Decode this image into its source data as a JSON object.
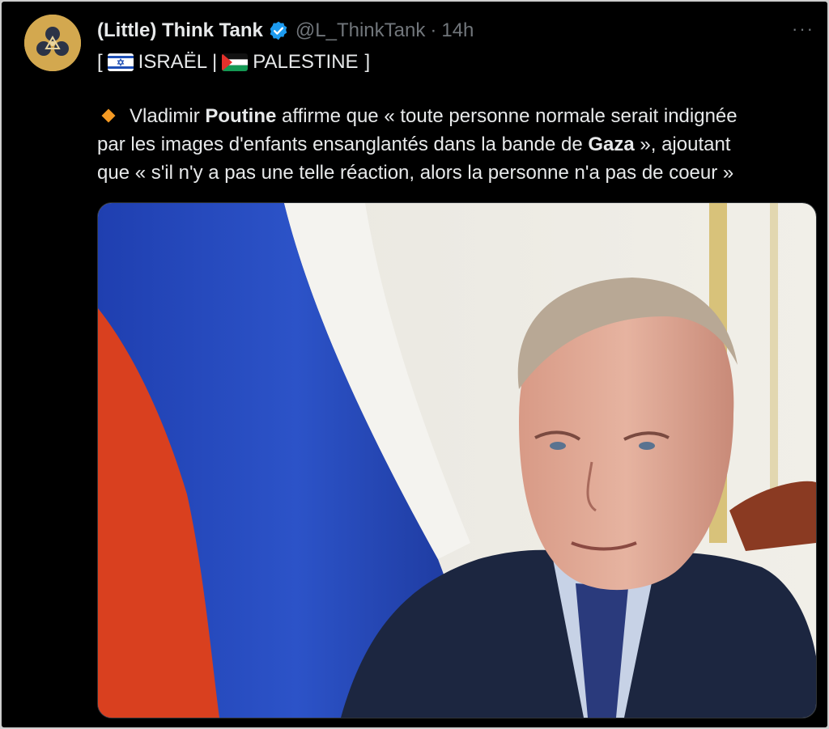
{
  "tweet": {
    "author_name": "(Little) Think Tank",
    "handle": "@L_ThinkTank",
    "separator": "·",
    "time": "14h",
    "more_label": "···",
    "tags": {
      "open": "[",
      "israel": "ISRAËL",
      "divider": "|",
      "palestine": "PALESTINE",
      "close": "]"
    },
    "body": {
      "l1_a": "Vladimir ",
      "l1_b": "Poutine",
      "l1_c": " affirme que « toute personne normale serait indignée",
      "l2_a": "par les images d'enfants ensanglantés dans la bande de ",
      "l2_b": "Gaza",
      "l2_c": " », ajoutant",
      "l3": "que « s'il n'y a pas une telle réaction, alors la personne n'a pas de coeur »"
    }
  },
  "colors": {
    "background": "#000000",
    "primary_text": "#e7e9ea",
    "secondary_text": "#71767b",
    "verified_badge": "#1d9bf0",
    "diamond_emoji": "#f59a23"
  },
  "icons": [
    "verified-badge-icon",
    "more-icon",
    "israel-flag-icon",
    "palestine-flag-icon",
    "orange-diamond-icon"
  ]
}
